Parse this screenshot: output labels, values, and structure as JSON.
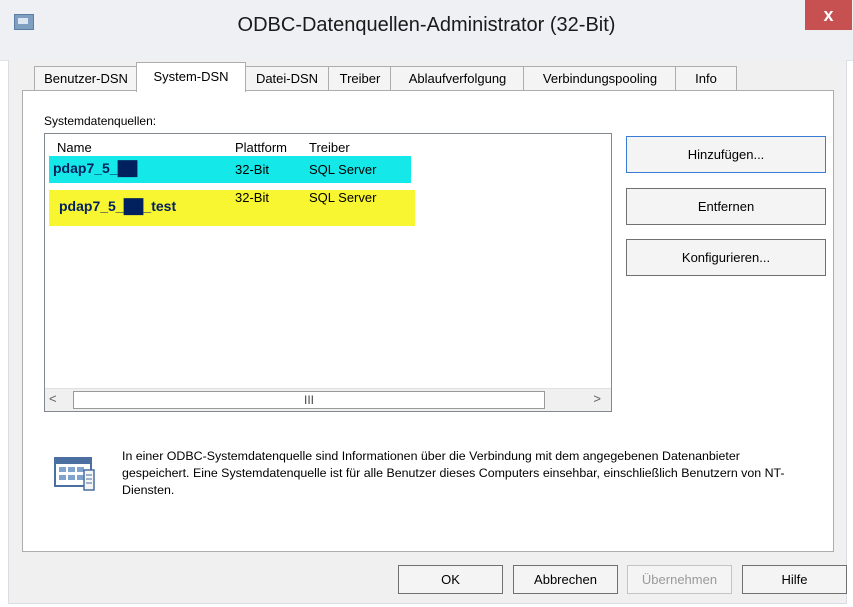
{
  "window": {
    "title": "ODBC-Datenquellen-Administrator (32-Bit)",
    "close_label": "x"
  },
  "tabs": [
    {
      "label": "Benutzer-DSN",
      "active": false
    },
    {
      "label": "System-DSN",
      "active": true
    },
    {
      "label": "Datei-DSN",
      "active": false
    },
    {
      "label": "Treiber",
      "active": false
    },
    {
      "label": "Ablaufverfolgung",
      "active": false
    },
    {
      "label": "Verbindungspooling",
      "active": false
    },
    {
      "label": "Info",
      "active": false
    }
  ],
  "systemdsn": {
    "group_label": "Systemdatenquellen:",
    "columns": [
      "Name",
      "Plattform",
      "Treiber"
    ],
    "rows": [
      {
        "name": "pdap7_5_██",
        "platform": "32-Bit",
        "driver": "SQL Server",
        "highlight": "#15e8e9"
      },
      {
        "name": "pdap7_5_██_test",
        "platform": "32-Bit",
        "driver": "SQL Server",
        "highlight": "#f8f531"
      }
    ],
    "scroll_left": "<",
    "scroll_right": ">",
    "scroll_thumb": "III",
    "buttons": {
      "add": "Hinzufügen...",
      "remove": "Entfernen",
      "configure": "Konfigurieren..."
    },
    "info_text": "In einer ODBC-Systemdatenquelle sind Informationen über die Verbindung mit dem angegebenen Datenanbieter gespeichert. Eine Systemdatenquelle ist für alle Benutzer dieses Computers einsehbar, einschließlich Benutzern von NT-Diensten."
  },
  "footer": {
    "ok": "OK",
    "cancel": "Abbrechen",
    "apply": "Übernehmen",
    "help": "Hilfe"
  },
  "colors": {
    "titlebar": "#eef0f3",
    "close": "#c75050",
    "focus_border": "#3a7bd5"
  }
}
